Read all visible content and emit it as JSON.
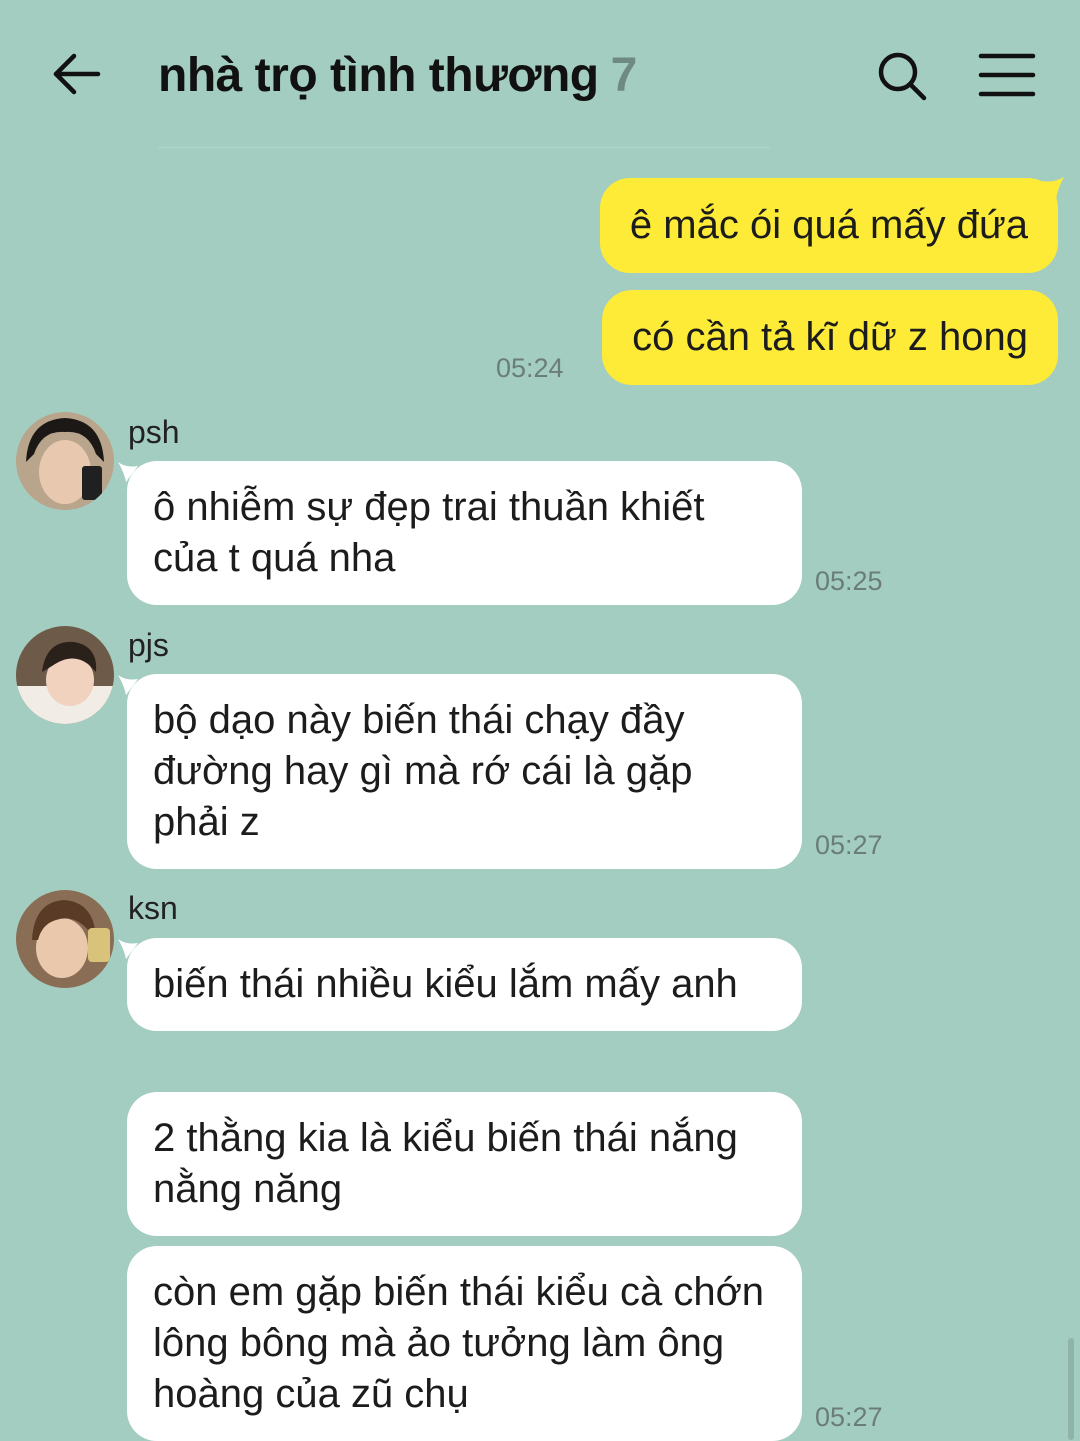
{
  "header": {
    "title": "nhà trọ tình thương",
    "member_count": "7",
    "back_icon": "arrow-left-icon",
    "search_icon": "search-icon",
    "menu_icon": "hamburger-menu-icon"
  },
  "colors": {
    "background": "#a4cdc1",
    "my_bubble": "#fdeb37",
    "other_bubble": "#ffffff"
  },
  "my_messages": {
    "items": [
      {
        "text": "ê mắc ói quá mấy đứa"
      },
      {
        "text": "có cần tả kĩ dữ z hong"
      }
    ],
    "time": "05:24"
  },
  "groups": [
    {
      "sender": "psh",
      "messages": [
        {
          "text": "ô nhiễm sự đẹp trai thuần khiết của t quá nha"
        }
      ],
      "time": "05:25"
    },
    {
      "sender": "pjs",
      "messages": [
        {
          "text": "bộ dạo này biến thái chạy đầy đường hay gì mà rớ cái là gặp phải z"
        }
      ],
      "time": "05:27"
    },
    {
      "sender": "ksn",
      "messages": [
        {
          "text": "biến thái nhiều kiểu lắm mấy anh"
        },
        {
          "text": "2 thằng kia là kiểu biến thái nắng nằng năng"
        },
        {
          "text": "còn em gặp biến thái kiểu cà chớn lông bông mà ảo tưởng làm ông hoàng của zũ chụ"
        }
      ],
      "time": "05:27"
    }
  ]
}
